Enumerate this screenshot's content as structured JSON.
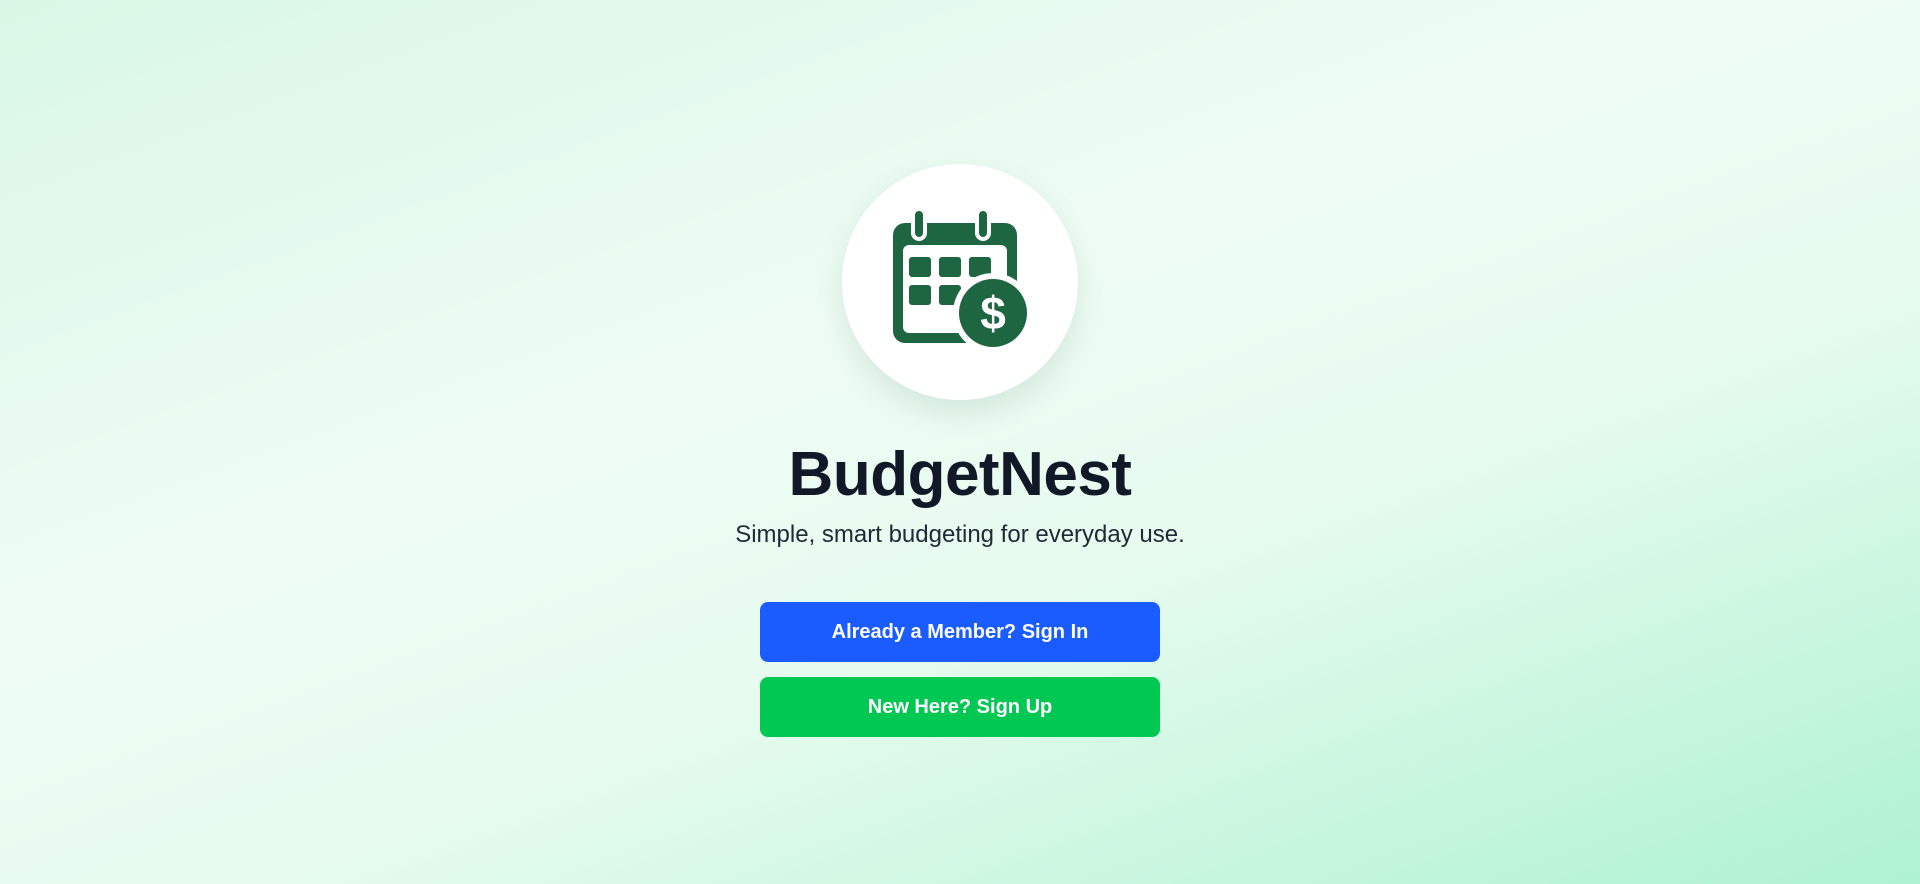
{
  "app": {
    "title": "BudgetNest",
    "tagline": "Simple, smart budgeting for everyday use."
  },
  "logo": {
    "icon": "calendar-dollar-icon",
    "color": "#1e6641"
  },
  "actions": {
    "signin_label": "Already a Member? Sign In",
    "signup_label": "New Here? Sign Up"
  },
  "colors": {
    "signin_button": "#1a5cff",
    "signup_button": "#00c853",
    "title_text": "#111827"
  }
}
